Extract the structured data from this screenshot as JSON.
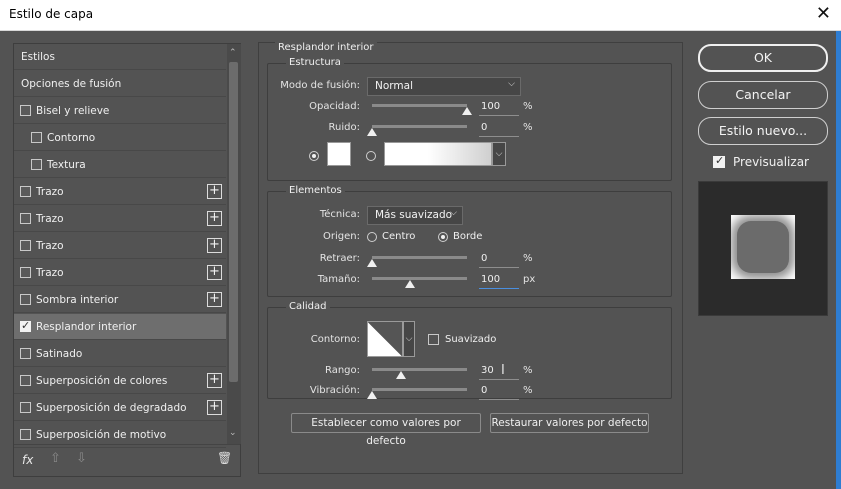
{
  "window": {
    "title": "Estilo de capa"
  },
  "left_list": {
    "header": "Estilos",
    "items": [
      {
        "label": "Opciones de fusión",
        "checkbox": false,
        "checked": false,
        "indent": false,
        "plus": false
      },
      {
        "label": "Bisel y relieve",
        "checkbox": true,
        "checked": false,
        "indent": false,
        "plus": false
      },
      {
        "label": "Contorno",
        "checkbox": true,
        "checked": false,
        "indent": true,
        "plus": false
      },
      {
        "label": "Textura",
        "checkbox": true,
        "checked": false,
        "indent": true,
        "plus": false
      },
      {
        "label": "Trazo",
        "checkbox": true,
        "checked": false,
        "indent": false,
        "plus": true
      },
      {
        "label": "Trazo",
        "checkbox": true,
        "checked": false,
        "indent": false,
        "plus": true
      },
      {
        "label": "Trazo",
        "checkbox": true,
        "checked": false,
        "indent": false,
        "plus": true
      },
      {
        "label": "Trazo",
        "checkbox": true,
        "checked": false,
        "indent": false,
        "plus": true
      },
      {
        "label": "Sombra interior",
        "checkbox": true,
        "checked": false,
        "indent": false,
        "plus": true
      },
      {
        "label": "Resplandor interior",
        "checkbox": true,
        "checked": true,
        "indent": false,
        "plus": false,
        "selected": true
      },
      {
        "label": "Satinado",
        "checkbox": true,
        "checked": false,
        "indent": false,
        "plus": false
      },
      {
        "label": "Superposición de colores",
        "checkbox": true,
        "checked": false,
        "indent": false,
        "plus": true
      },
      {
        "label": "Superposición de degradado",
        "checkbox": true,
        "checked": false,
        "indent": false,
        "plus": true
      },
      {
        "label": "Superposición de motivo",
        "checkbox": true,
        "checked": false,
        "indent": false,
        "plus": false
      }
    ],
    "footer": {
      "fx": "fx",
      "up": "⇧",
      "down": "⇩",
      "trash": "🗑"
    }
  },
  "panel": {
    "title": "Resplandor interior",
    "estructura": {
      "title": "Estructura",
      "blend_label": "Modo de fusión:",
      "blend_value": "Normal",
      "opacity_label": "Opacidad:",
      "opacity_value": "100",
      "opacity_unit": "%",
      "opacity_level": 1.0,
      "noise_label": "Ruido:",
      "noise_value": "0",
      "noise_unit": "%",
      "noise_level": 0.0
    },
    "elementos": {
      "title": "Elementos",
      "technique_label": "Técnica:",
      "technique_value": "Más suavizado",
      "source_label": "Origen:",
      "source_center": "Centro",
      "source_edge": "Borde",
      "choke_label": "Retraer:",
      "choke_value": "0",
      "choke_unit": "%",
      "choke_level": 0.0,
      "size_label": "Tamaño:",
      "size_value": "100",
      "size_unit": "px",
      "size_level": 0.4
    },
    "calidad": {
      "title": "Calidad",
      "contour_label": "Contorno:",
      "antialias_label": "Suavizado",
      "range_label": "Rango:",
      "range_value": "30",
      "range_unit": "%",
      "range_level": 0.3,
      "jitter_label": "Vibración:",
      "jitter_value": "0",
      "jitter_unit": "%",
      "jitter_level": 0.0
    },
    "default_button": "Establecer como valores por defecto",
    "reset_button": "Restaurar valores por defecto"
  },
  "right": {
    "ok": "OK",
    "cancel": "Cancelar",
    "new_style": "Estilo nuevo...",
    "preview_label": "Previsualizar"
  },
  "colors": {
    "accent": "#2e7dd2",
    "panel_bg": "#535353",
    "selected_row": "#6e6e6e"
  }
}
